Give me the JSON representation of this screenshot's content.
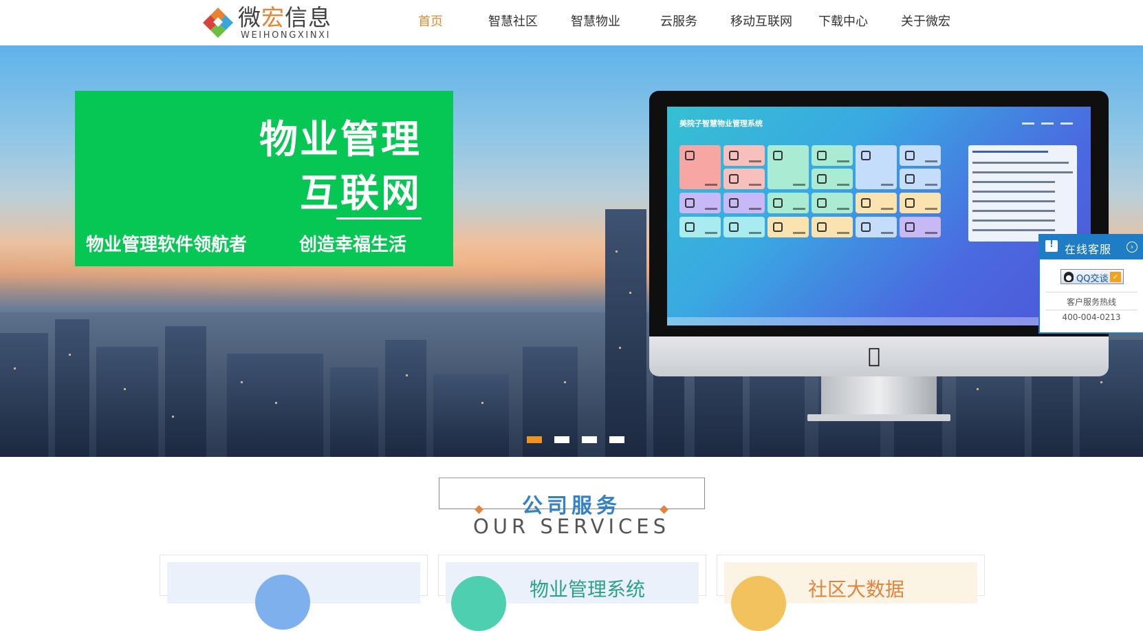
{
  "brand": {
    "cn_prefix": "微",
    "cn_highlight": "宏",
    "cn_suffix": "信息",
    "en": "WEIHONGXINXI",
    "accent": "#e98331"
  },
  "nav": {
    "items": [
      {
        "label": "首页",
        "active": true
      },
      {
        "label": "智慧社区"
      },
      {
        "label": "智慧物业"
      },
      {
        "label": "云服务"
      },
      {
        "label": "移动互联网"
      },
      {
        "label": "下载中心"
      },
      {
        "label": "关于微宏"
      }
    ],
    "active_color": "#e58a2b"
  },
  "banner": {
    "promo": {
      "line1": "物业管理",
      "line2": "互联网",
      "sub1": "物业管理软件领航者",
      "sub2": "创造幸福生活",
      "bg": "#06c654"
    },
    "screen_title": "美院子智慧物业管理系统",
    "slides": {
      "count": 4,
      "active_index": 0,
      "active_color": "#f09323"
    }
  },
  "customer_service": {
    "title": "在线客服",
    "qq_label": "QQ交谈",
    "hotline_label": "客户服务热线",
    "hotline_number": "400-004-0213",
    "color": "#1f7dc6"
  },
  "services": {
    "title": "公司服务",
    "subtitle": "OUR SERVICES",
    "title_color": "#3382c8",
    "cards": [
      {
        "title": "",
        "bg": "#eaf1fb",
        "circle": "#7fb0ee"
      },
      {
        "title": "物业管理系统",
        "bg": "#eaf1fb",
        "circle": "#4ecfb0",
        "title_color": "#2aa18a"
      },
      {
        "title": "社区大数据",
        "bg": "#fbf4e4",
        "circle": "#f2c35d",
        "title_color": "#e2843b"
      }
    ]
  }
}
